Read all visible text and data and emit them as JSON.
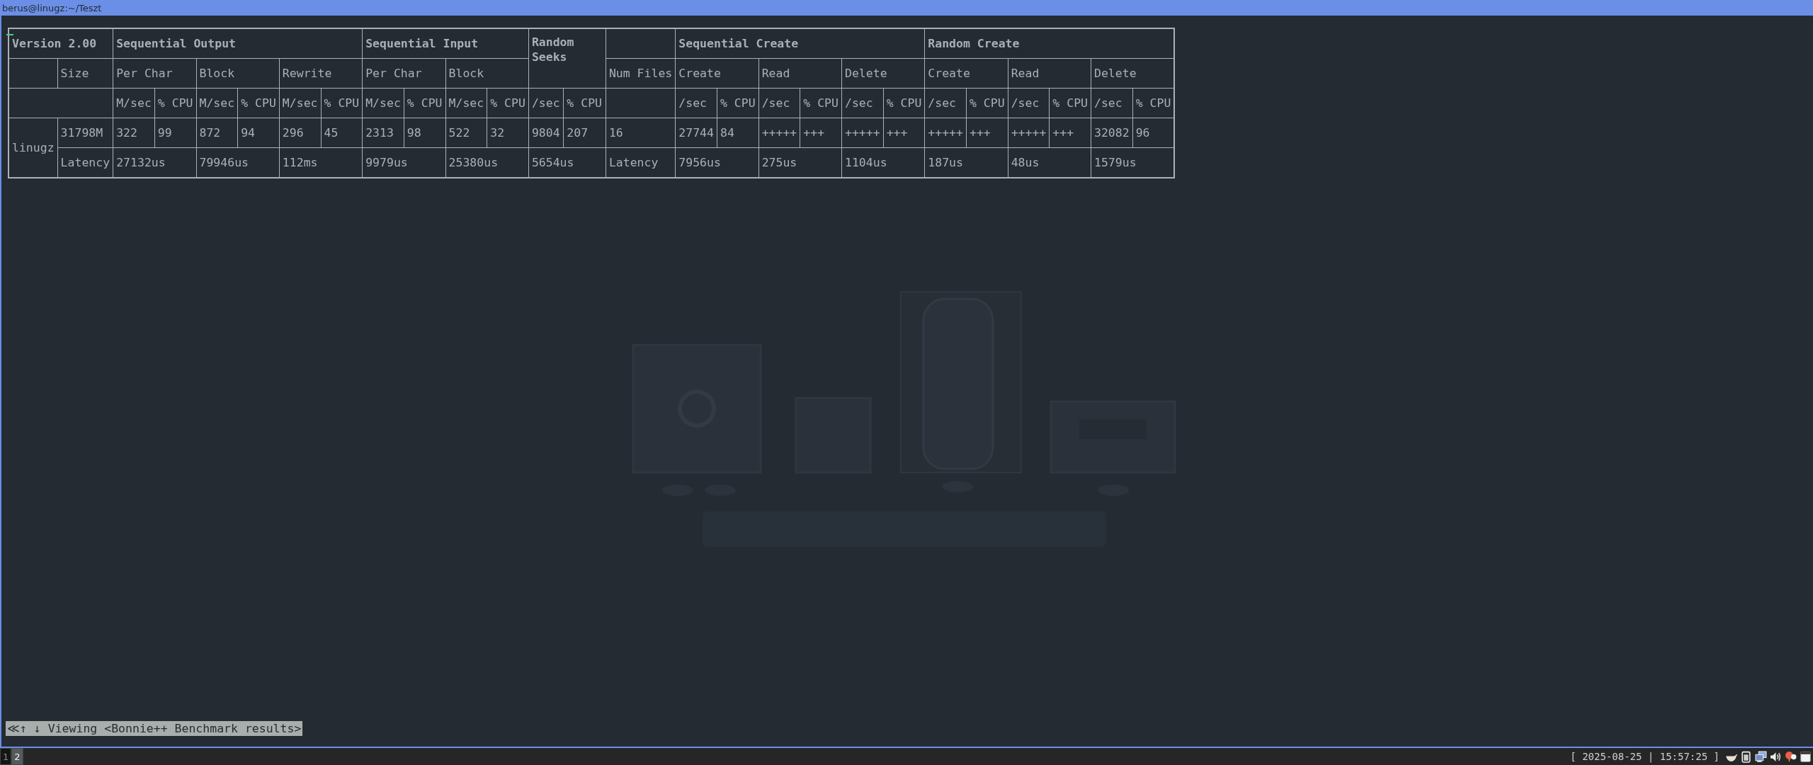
{
  "window": {
    "title": "berus@linugz:~/Teszt"
  },
  "table": {
    "rows": [
      {
        "kind": "group",
        "cells": [
          {
            "text": "Version 2.00",
            "colspan": 2
          },
          {
            "text": "Sequential Output",
            "colspan": 6
          },
          {
            "text": "Sequential Input",
            "colspan": 4
          },
          {
            "text": "Random Seeks",
            "colspan": 2,
            "rowspan": 2
          },
          {},
          {
            "text": "Sequential Create",
            "colspan": 6
          },
          {
            "text": "Random Create",
            "colspan": 6
          }
        ]
      },
      {
        "kind": "plain",
        "cells": [
          {},
          {
            "text": "Size"
          },
          {
            "text": "Per Char",
            "colspan": 2
          },
          {
            "text": "Block",
            "colspan": 2
          },
          {
            "text": "Rewrite",
            "colspan": 2
          },
          {
            "text": "Per Char",
            "colspan": 2
          },
          {
            "text": "Block",
            "colspan": 2
          },
          {
            "text": "Num Files"
          },
          {
            "text": "Create",
            "colspan": 2
          },
          {
            "text": "Read",
            "colspan": 2
          },
          {
            "text": "Delete",
            "colspan": 2
          },
          {
            "text": "Create",
            "colspan": 2
          },
          {
            "text": "Read",
            "colspan": 2
          },
          {
            "text": "Delete",
            "colspan": 2
          }
        ]
      },
      {
        "kind": "plain",
        "cells": [
          {
            "colspan": 2
          },
          {
            "text": "M/sec"
          },
          {
            "text": "% CPU"
          },
          {
            "text": "M/sec"
          },
          {
            "text": "% CPU"
          },
          {
            "text": "M/sec"
          },
          {
            "text": "% CPU"
          },
          {
            "text": "M/sec"
          },
          {
            "text": "% CPU"
          },
          {
            "text": "M/sec"
          },
          {
            "text": "% CPU"
          },
          {
            "text": "/sec"
          },
          {
            "text": "% CPU"
          },
          {},
          {
            "text": "/sec"
          },
          {
            "text": "% CPU"
          },
          {
            "text": "/sec"
          },
          {
            "text": "% CPU"
          },
          {
            "text": "/sec"
          },
          {
            "text": "% CPU"
          },
          {
            "text": "/sec"
          },
          {
            "text": "% CPU"
          },
          {
            "text": "/sec"
          },
          {
            "text": "% CPU"
          },
          {
            "text": "/sec"
          },
          {
            "text": "% CPU"
          }
        ]
      },
      {
        "kind": "plain",
        "cells": [
          {
            "text": "linugz",
            "rowspan": 2
          },
          {
            "text": "31798M"
          },
          {
            "text": "322"
          },
          {
            "text": "99"
          },
          {
            "text": "872"
          },
          {
            "text": "94"
          },
          {
            "text": "296"
          },
          {
            "text": "45"
          },
          {
            "text": "2313"
          },
          {
            "text": "98"
          },
          {
            "text": "522"
          },
          {
            "text": "32"
          },
          {
            "text": "9804"
          },
          {
            "text": "207"
          },
          {
            "text": "16"
          },
          {
            "text": "27744"
          },
          {
            "text": "84"
          },
          {
            "text": "+++++"
          },
          {
            "text": "+++"
          },
          {
            "text": "+++++"
          },
          {
            "text": "+++"
          },
          {
            "text": "+++++"
          },
          {
            "text": "+++"
          },
          {
            "text": "+++++"
          },
          {
            "text": "+++"
          },
          {
            "text": "32082"
          },
          {
            "text": "96"
          }
        ]
      },
      {
        "kind": "plain",
        "cells": [
          {
            "text": "Latency"
          },
          {
            "text": "27132us",
            "colspan": 2
          },
          {
            "text": "79946us",
            "colspan": 2
          },
          {
            "text": "112ms",
            "colspan": 2
          },
          {
            "text": "9979us",
            "colspan": 2
          },
          {
            "text": "25380us",
            "colspan": 2
          },
          {
            "text": "5654us",
            "colspan": 2
          },
          {
            "text": "Latency"
          },
          {
            "text": "7956us",
            "colspan": 2
          },
          {
            "text": "275us",
            "colspan": 2
          },
          {
            "text": "1104us",
            "colspan": 2
          },
          {
            "text": "187us",
            "colspan": 2
          },
          {
            "text": "48us",
            "colspan": 2
          },
          {
            "text": "1579us",
            "colspan": 2
          }
        ]
      }
    ]
  },
  "status_line": "≪↑ ↓ Viewing <Bonnie++ Benchmark results>",
  "taskbar": {
    "workspaces": [
      {
        "label": "1",
        "selected": false
      },
      {
        "label": "2",
        "selected": true
      }
    ],
    "clock": "[ 2025-08-25 | 15:57:25 ]"
  }
}
